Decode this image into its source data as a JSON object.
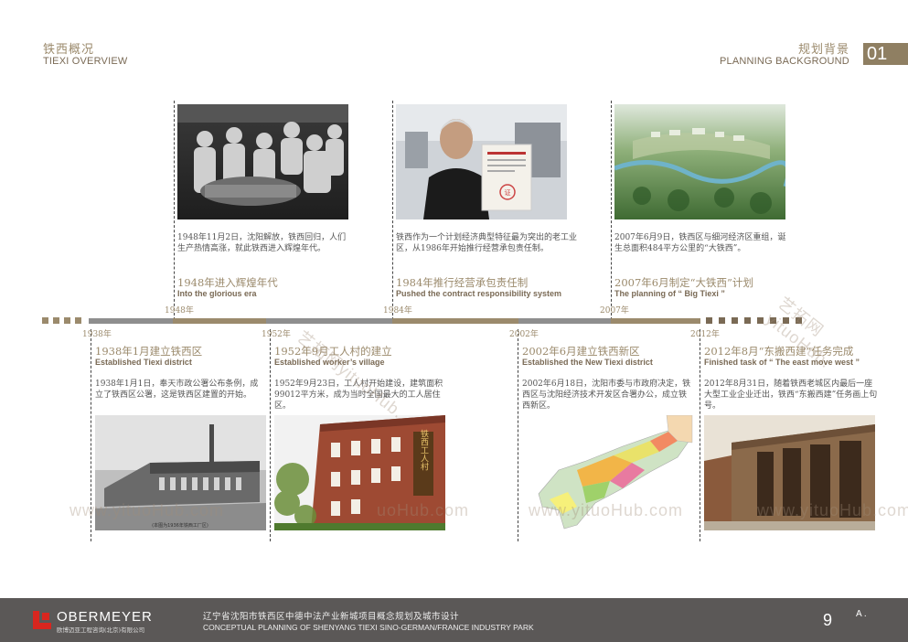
{
  "header": {
    "left_cn": "铁西概况",
    "left_en": "TIEXI OVERVIEW",
    "right_cn": "规划背景",
    "right_en": "PLANNING BACKGROUND",
    "section_no": "01"
  },
  "top_events": [
    {
      "desc": "1948年11月2日，沈阳解放，铁西回归，人们生产热情高涨，就此铁西进入辉煌年代。",
      "title_cn": "1948年进入辉煌年代",
      "title_en": "Into the glorious era"
    },
    {
      "desc": "铁西作为一个计划经济典型特征最为突出的老工业区，从1986年开始推行经营承包责任制。",
      "title_cn": "1984年推行经营承包责任制",
      "title_en": "Pushed the contract responsibility system"
    },
    {
      "desc": "2007年6月9日，铁西区与细河经济区重组，诞生总面积484平方公里的“大铁西”。",
      "title_cn": "2007年6月制定“大铁西”计划",
      "title_en": "The planning of “ Big Tiexi ”"
    }
  ],
  "bottom_events": [
    {
      "title_cn": "1938年1月建立铁西区",
      "title_en": "Established Tiexi district",
      "desc": "1938年1月1日，奉天市政公署公布条例，成立了铁西区公署，这是铁西区建置的开始。"
    },
    {
      "title_cn": "1952年9月工人村的建立",
      "title_en": "Established worker’s village",
      "desc": "1952年9月23日，工人村开始建设，建筑面积99012平方米，成为当时全国最大的工人居住区。"
    },
    {
      "title_cn": "2002年6月建立铁西新区",
      "title_en": "Established the New Tiexi district",
      "desc": "2002年6月18日，沈阳市委与市政府决定，铁西区与沈阳经济技术开发区合署办公，成立铁西新区。"
    },
    {
      "title_cn": "2012年8月“东搬西建”任务完成",
      "title_en": "Finished task of “ The east move west ”",
      "desc": "2012年8月31日，随着铁西老城区内最后一座大型工业企业迁出，铁西“东搬西建”任务画上句号。"
    }
  ],
  "timeline": {
    "years_top": [
      "1948年",
      "1984年",
      "2007年"
    ],
    "years_bottom": [
      "1938年",
      "1952年",
      "2002年",
      "2012年"
    ],
    "colors": {
      "gray": "#8e8e8e",
      "brown": "#9b8a6c",
      "dark": "#7a6a55"
    }
  },
  "watermark": {
    "diag": "艺拓网yituoHub.",
    "url": "www.yituoHub.com",
    "url_frag": "uoHub.com"
  },
  "photo_texts": {
    "sign": "铁西工人村",
    "stamp": "证",
    "caption": "(本图为1936年铁西工厂区)"
  },
  "footer": {
    "brand": "OBERMEYER",
    "brand_sub": "欧博迈亚工程咨询(北京)有限公司",
    "title_cn": "辽宁省沈阳市铁西区中德中法产业新城项目概念规划及城市设计",
    "title_en": "CONCEPTUAL PLANNING OF SHENYANG TIEXI SINO-GERMAN/FRANCE  INDUSTRY PARK",
    "page": "9",
    "corner": "A ."
  }
}
